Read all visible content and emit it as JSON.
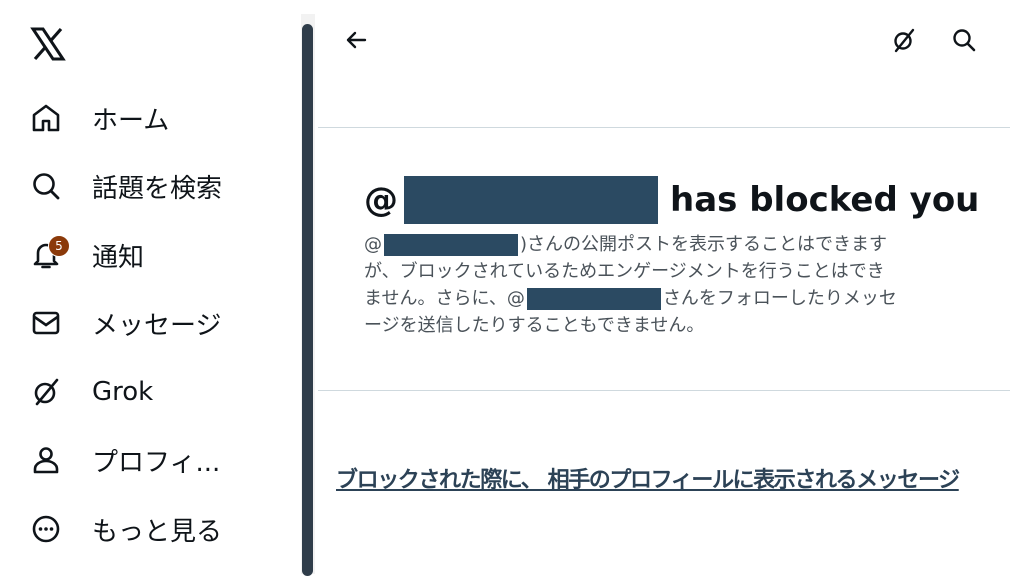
{
  "sidebar": {
    "logo_icon": "x-logo-icon",
    "items": [
      {
        "label": "ホーム",
        "icon": "home-icon"
      },
      {
        "label": "話題を検索",
        "icon": "search-icon"
      },
      {
        "label": "通知",
        "icon": "bell-icon",
        "badge": "5"
      },
      {
        "label": "メッセージ",
        "icon": "envelope-icon"
      },
      {
        "label": "Grok",
        "icon": "grok-icon"
      },
      {
        "label": "プロフィ...",
        "icon": "person-icon"
      },
      {
        "label": "もっと見る",
        "icon": "more-circle-icon"
      }
    ]
  },
  "header": {
    "back_icon": "back-arrow-icon",
    "grok_icon": "grok-icon",
    "search_icon": "search-icon"
  },
  "blocked": {
    "at_sign": "@",
    "title_suffix": "has blocked you",
    "desc_line1_prefix": "@",
    "desc_line1_suffix": ")さんの公開ポストを表示することはできます",
    "desc_line2": "が、ブロックされているためエンゲージメントを行うことはでき",
    "desc_line3_prefix": "ません。さらに、@",
    "desc_line3_suffix": "さんをフォローしたりメッセ",
    "desc_line4": "ージを送信したりすることもできません。"
  },
  "link": {
    "text": "ブロックされた際に、 相手のプロフィールに表示されるメッセージ"
  },
  "colors": {
    "redaction": "#2b4a62",
    "badge": "#8b3a0a",
    "link": "#2c4256",
    "divider": "#cfd9de"
  }
}
